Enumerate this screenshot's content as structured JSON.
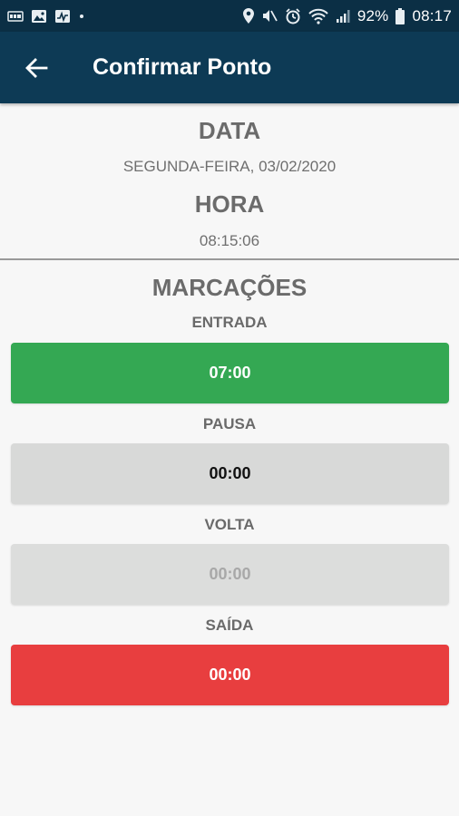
{
  "status_bar": {
    "battery": "92%",
    "time": "08:17"
  },
  "header": {
    "title": "Confirmar Ponto"
  },
  "info": {
    "data_title": "DATA",
    "data_value": "SEGUNDA-FEIRA, 03/02/2020",
    "hora_title": "HORA",
    "hora_value": "08:15:06"
  },
  "marcacoes": {
    "title": "MARCAÇÕES",
    "entrada": {
      "label": "ENTRADA",
      "value": "07:00",
      "color": "#34a853",
      "text_color": "#ffffff"
    },
    "pausa": {
      "label": "PAUSA",
      "value": "00:00",
      "color": "#d8d9d8",
      "text_color": "#111111"
    },
    "volta": {
      "label": "VOLTA",
      "value": "00:00",
      "color": "#dcdddc",
      "text_color": "#a8a8a8"
    },
    "saida": {
      "label": "SAÍDA",
      "value": "00:00",
      "color": "#e83e3f",
      "text_color": "#ffffff"
    }
  }
}
